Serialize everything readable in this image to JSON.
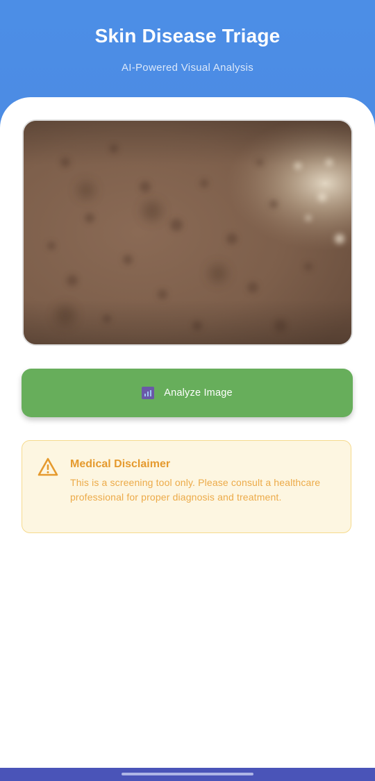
{
  "header": {
    "title": "Skin Disease Triage",
    "subtitle": "AI-Powered Visual Analysis"
  },
  "preview": {
    "icon": "skin-photo-preview"
  },
  "actions": {
    "analyze_label": "Analyze Image",
    "analyze_icon": "analytics-chart-icon",
    "analyze_color": "#67ae5b"
  },
  "disclaimer": {
    "icon": "warning-triangle-icon",
    "title": "Medical Disclaimer",
    "text": "This is a screening tool only. Please consult a healthcare professional for proper diagnosis and treatment.",
    "accent_color": "#e59a2e",
    "background_color": "#fdf6e1"
  },
  "colors": {
    "header_gradient_start": "#4c8ee6",
    "header_gradient_end": "#4a7fd9",
    "navbar": "#4a54b8"
  }
}
